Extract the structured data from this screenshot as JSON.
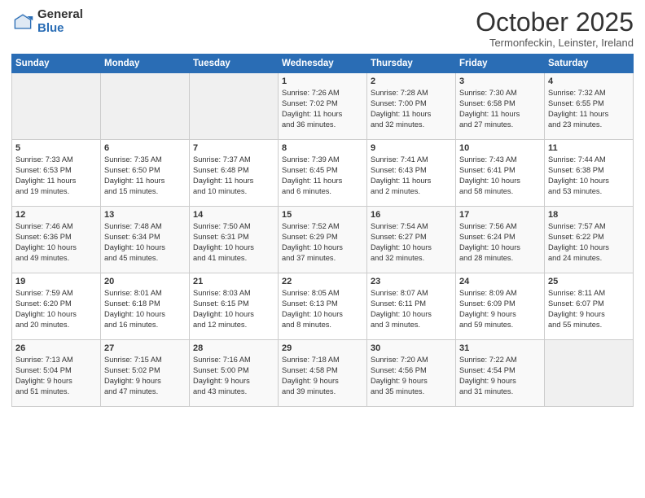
{
  "header": {
    "logo_general": "General",
    "logo_blue": "Blue",
    "month": "October 2025",
    "location": "Termonfeckin, Leinster, Ireland"
  },
  "days_of_week": [
    "Sunday",
    "Monday",
    "Tuesday",
    "Wednesday",
    "Thursday",
    "Friday",
    "Saturday"
  ],
  "weeks": [
    [
      {
        "day": "",
        "content": ""
      },
      {
        "day": "",
        "content": ""
      },
      {
        "day": "",
        "content": ""
      },
      {
        "day": "1",
        "content": "Sunrise: 7:26 AM\nSunset: 7:02 PM\nDaylight: 11 hours\nand 36 minutes."
      },
      {
        "day": "2",
        "content": "Sunrise: 7:28 AM\nSunset: 7:00 PM\nDaylight: 11 hours\nand 32 minutes."
      },
      {
        "day": "3",
        "content": "Sunrise: 7:30 AM\nSunset: 6:58 PM\nDaylight: 11 hours\nand 27 minutes."
      },
      {
        "day": "4",
        "content": "Sunrise: 7:32 AM\nSunset: 6:55 PM\nDaylight: 11 hours\nand 23 minutes."
      }
    ],
    [
      {
        "day": "5",
        "content": "Sunrise: 7:33 AM\nSunset: 6:53 PM\nDaylight: 11 hours\nand 19 minutes."
      },
      {
        "day": "6",
        "content": "Sunrise: 7:35 AM\nSunset: 6:50 PM\nDaylight: 11 hours\nand 15 minutes."
      },
      {
        "day": "7",
        "content": "Sunrise: 7:37 AM\nSunset: 6:48 PM\nDaylight: 11 hours\nand 10 minutes."
      },
      {
        "day": "8",
        "content": "Sunrise: 7:39 AM\nSunset: 6:45 PM\nDaylight: 11 hours\nand 6 minutes."
      },
      {
        "day": "9",
        "content": "Sunrise: 7:41 AM\nSunset: 6:43 PM\nDaylight: 11 hours\nand 2 minutes."
      },
      {
        "day": "10",
        "content": "Sunrise: 7:43 AM\nSunset: 6:41 PM\nDaylight: 10 hours\nand 58 minutes."
      },
      {
        "day": "11",
        "content": "Sunrise: 7:44 AM\nSunset: 6:38 PM\nDaylight: 10 hours\nand 53 minutes."
      }
    ],
    [
      {
        "day": "12",
        "content": "Sunrise: 7:46 AM\nSunset: 6:36 PM\nDaylight: 10 hours\nand 49 minutes."
      },
      {
        "day": "13",
        "content": "Sunrise: 7:48 AM\nSunset: 6:34 PM\nDaylight: 10 hours\nand 45 minutes."
      },
      {
        "day": "14",
        "content": "Sunrise: 7:50 AM\nSunset: 6:31 PM\nDaylight: 10 hours\nand 41 minutes."
      },
      {
        "day": "15",
        "content": "Sunrise: 7:52 AM\nSunset: 6:29 PM\nDaylight: 10 hours\nand 37 minutes."
      },
      {
        "day": "16",
        "content": "Sunrise: 7:54 AM\nSunset: 6:27 PM\nDaylight: 10 hours\nand 32 minutes."
      },
      {
        "day": "17",
        "content": "Sunrise: 7:56 AM\nSunset: 6:24 PM\nDaylight: 10 hours\nand 28 minutes."
      },
      {
        "day": "18",
        "content": "Sunrise: 7:57 AM\nSunset: 6:22 PM\nDaylight: 10 hours\nand 24 minutes."
      }
    ],
    [
      {
        "day": "19",
        "content": "Sunrise: 7:59 AM\nSunset: 6:20 PM\nDaylight: 10 hours\nand 20 minutes."
      },
      {
        "day": "20",
        "content": "Sunrise: 8:01 AM\nSunset: 6:18 PM\nDaylight: 10 hours\nand 16 minutes."
      },
      {
        "day": "21",
        "content": "Sunrise: 8:03 AM\nSunset: 6:15 PM\nDaylight: 10 hours\nand 12 minutes."
      },
      {
        "day": "22",
        "content": "Sunrise: 8:05 AM\nSunset: 6:13 PM\nDaylight: 10 hours\nand 8 minutes."
      },
      {
        "day": "23",
        "content": "Sunrise: 8:07 AM\nSunset: 6:11 PM\nDaylight: 10 hours\nand 3 minutes."
      },
      {
        "day": "24",
        "content": "Sunrise: 8:09 AM\nSunset: 6:09 PM\nDaylight: 9 hours\nand 59 minutes."
      },
      {
        "day": "25",
        "content": "Sunrise: 8:11 AM\nSunset: 6:07 PM\nDaylight: 9 hours\nand 55 minutes."
      }
    ],
    [
      {
        "day": "26",
        "content": "Sunrise: 7:13 AM\nSunset: 5:04 PM\nDaylight: 9 hours\nand 51 minutes."
      },
      {
        "day": "27",
        "content": "Sunrise: 7:15 AM\nSunset: 5:02 PM\nDaylight: 9 hours\nand 47 minutes."
      },
      {
        "day": "28",
        "content": "Sunrise: 7:16 AM\nSunset: 5:00 PM\nDaylight: 9 hours\nand 43 minutes."
      },
      {
        "day": "29",
        "content": "Sunrise: 7:18 AM\nSunset: 4:58 PM\nDaylight: 9 hours\nand 39 minutes."
      },
      {
        "day": "30",
        "content": "Sunrise: 7:20 AM\nSunset: 4:56 PM\nDaylight: 9 hours\nand 35 minutes."
      },
      {
        "day": "31",
        "content": "Sunrise: 7:22 AM\nSunset: 4:54 PM\nDaylight: 9 hours\nand 31 minutes."
      },
      {
        "day": "",
        "content": ""
      }
    ]
  ]
}
